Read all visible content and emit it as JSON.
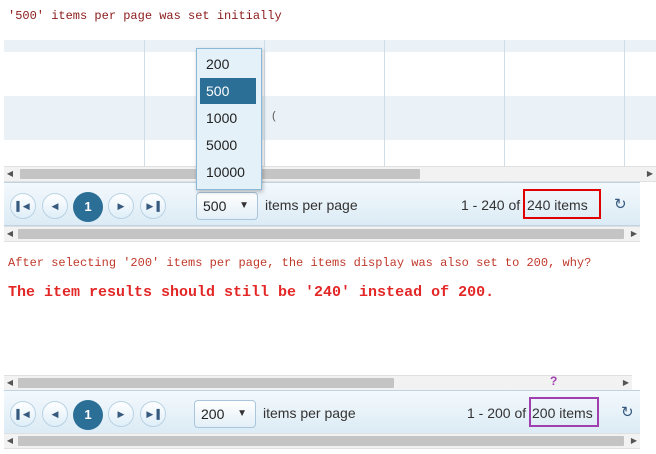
{
  "notes": {
    "top": "'500' items per page was set initially",
    "middle": "After selecting '200' items per page, the items display was also set to 200, why?",
    "emphasis": "The item results should still be '240' instead of 200.",
    "question_mark": "?"
  },
  "grid_top": {
    "fragment": "("
  },
  "pager_top": {
    "current_page": "1",
    "page_size": "500",
    "items_per_page_label": "items per page",
    "range": "1 - 240 of",
    "total": "240 items"
  },
  "dropdown": {
    "options": [
      "200",
      "500",
      "1000",
      "5000",
      "10000"
    ],
    "selected": "500"
  },
  "pager_bottom": {
    "current_page": "1",
    "page_size": "200",
    "items_per_page_label": "items per page",
    "range": "1 - 200 of",
    "total": "200 items"
  },
  "icons": {
    "first": "first-page-icon",
    "prev": "prev-page-icon",
    "next": "next-page-icon",
    "last": "last-page-icon",
    "refresh": "refresh-icon",
    "caret": "chevron-down-icon"
  },
  "colors": {
    "accent": "#2b6e96",
    "highlight_red": "#e00000",
    "highlight_purple": "#a040b0",
    "note_red": "#e32727"
  }
}
